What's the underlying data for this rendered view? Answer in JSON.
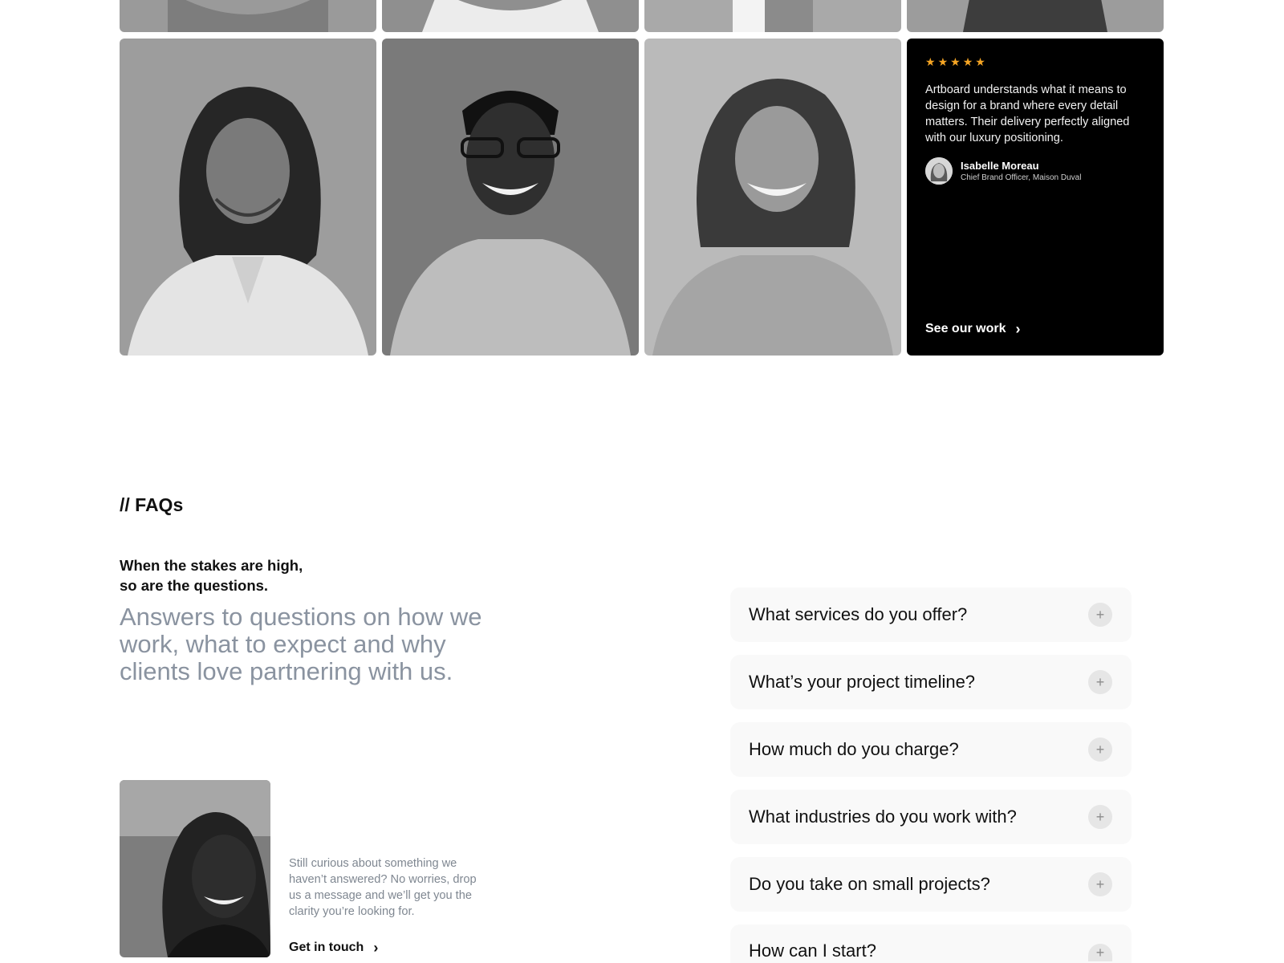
{
  "testimonial": {
    "rating_icon": "star-icon",
    "rating": 5,
    "star_color": "#f5a524",
    "quote": "Artboard understands what it means to design for a brand where every detail matters. Their delivery perfectly aligned with our luxury positioning.",
    "author_name": "Isabelle Moreau",
    "author_role": "Chief Brand Officer, Maison Duval",
    "cta_label": "See our work",
    "cta_icon": "chevron-right-icon"
  },
  "faq": {
    "tag": "// FAQs",
    "subheading_line1": "When the stakes are high,",
    "subheading_line2": "so are the questions.",
    "lead": "Answers to questions on how we work, what to expect and why clients love partnering with us.",
    "support_text": "Still curious about something we haven’t answered? No worries, drop us a message and we’ll get you the clarity you’re looking for.",
    "cta_label": "Get in touch",
    "cta_icon": "chevron-right-icon",
    "expand_icon": "plus-icon",
    "items": [
      {
        "question": "What services do you offer?"
      },
      {
        "question": "What’s your project timeline?"
      },
      {
        "question": "How much do you charge?"
      },
      {
        "question": "What industries do you work with?"
      },
      {
        "question": "Do you take on small projects?"
      },
      {
        "question": "How can I start?"
      }
    ]
  },
  "colors": {
    "accent_star": "#f5a524",
    "lead_text": "#8a93a0",
    "faq_card_bg": "#f9f9f9",
    "testimonial_bg": "#000000"
  }
}
